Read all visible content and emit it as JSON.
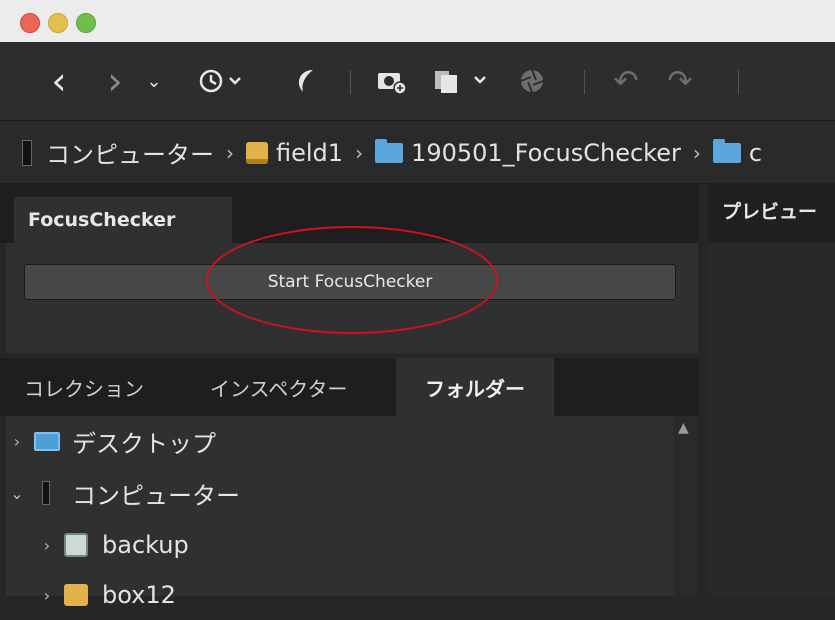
{
  "toolbar": {
    "back": "‹",
    "forward": "›",
    "dropdown": "⌄",
    "history": "◷",
    "undo": "↶",
    "redo": "↷"
  },
  "breadcrumb": {
    "items": [
      {
        "label": "コンピューター",
        "icon": "computer-icon"
      },
      {
        "label": "field1",
        "icon": "drive-icon"
      },
      {
        "label": "190501_FocusChecker",
        "icon": "folder-icon"
      },
      {
        "label": "c",
        "icon": "folder-icon"
      }
    ],
    "separator": "›"
  },
  "plugin_panel": {
    "tab_label": "FocusChecker",
    "button_label": "Start FocusChecker"
  },
  "bottom_tabs": [
    {
      "label": "コレクション",
      "active": false
    },
    {
      "label": "インスペクター",
      "active": false
    },
    {
      "label": "フォルダー",
      "active": true
    }
  ],
  "tree": [
    {
      "label": "デスクトップ",
      "disclosure": "›",
      "icon": "desktop-folder-icon"
    },
    {
      "label": "コンピューター",
      "disclosure": "⌄",
      "icon": "computer-icon"
    },
    {
      "label": "backup",
      "disclosure": "›",
      "icon": "backup-drive-icon"
    },
    {
      "label": "box12",
      "disclosure": "›",
      "icon": "drive-icon"
    }
  ],
  "preview_panel": {
    "tab_label": "プレビュー"
  },
  "colors": {
    "annotation": "#d0121b",
    "folder": "#5aa7dd",
    "drive": "#e4b24a"
  }
}
